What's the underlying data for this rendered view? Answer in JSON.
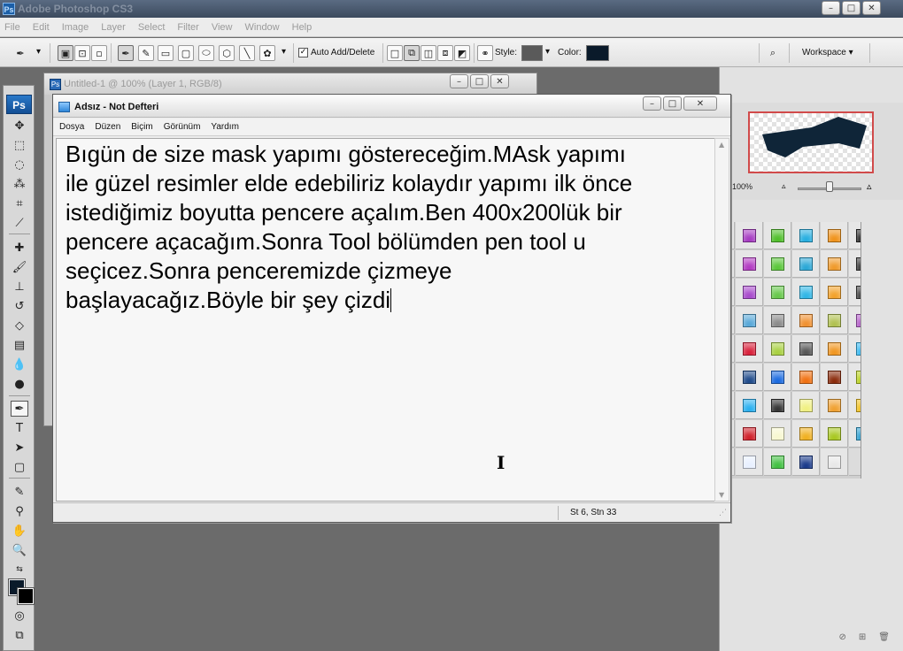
{
  "photoshop": {
    "title": "Adobe Photoshop CS3",
    "app_icon": "Ps",
    "menu": [
      "File",
      "Edit",
      "Image",
      "Layer",
      "Select",
      "Filter",
      "View",
      "Window",
      "Help"
    ],
    "options_bar": {
      "auto_add_delete_label": "Auto Add/Delete",
      "auto_add_delete_checked": "✓",
      "style_label": "Style:",
      "color_label": "Color:",
      "color_value": "#0a1a2a",
      "workspace_label": "Workspace"
    },
    "toolbox_badge": "Ps",
    "document": {
      "title": "Untitled-1 @ 100% (Layer 1, RGB/8)",
      "icon": "Ps"
    },
    "navigator": {
      "zoom_text": "100%"
    },
    "styles_colors": [
      [
        "#cf1a3a",
        "#a63bc2",
        "#4fbf2a",
        "#26aee0",
        "#f0921a",
        "#2b2b2b"
      ],
      [
        "#c9203a",
        "#b23ac2",
        "#5ac73a",
        "#2aa7d6",
        "#f09a2a",
        "#3a3a3a"
      ],
      [
        "#c0203a",
        "#a84acc",
        "#66c84a",
        "#2fb6e6",
        "#f3a22a",
        "#424242"
      ],
      [
        "#b8b8b8",
        "#58a8d8",
        "#8a8a8a",
        "#f09030",
        "#b0c050",
        "#b35ec8"
      ],
      [
        "#28a7c0",
        "#d8203a",
        "#a8d040",
        "#555555",
        "#f09620",
        "#38b8f0"
      ],
      [
        "#e82a5a",
        "#1e4a8a",
        "#1a6ae0",
        "#f07010",
        "#8a2a0a",
        "#b8d020"
      ],
      [
        "#111111",
        "#2ab0f0",
        "#333333",
        "#f0f080",
        "#f0a030",
        "#f0c020"
      ],
      [
        "#e0e0e0",
        "#d0202a",
        "#f8f8d0",
        "#f0b020",
        "#a8c820",
        "#30a0d0"
      ],
      [
        "#f0e8c8",
        "#e8f0ff",
        "#40c040",
        "#1a3a8a",
        "#e8e8e8",
        ""
      ]
    ]
  },
  "notepad": {
    "title": "Adsız - Not Defteri",
    "menu": [
      "Dosya",
      "Düzen",
      "Biçim",
      "Görünüm",
      "Yardım"
    ],
    "text": "Bıgün de size mask yapımı göstereceğim.MAsk yapımı\nile güzel resimler elde edebiliriz kolaydır yapımı ilk önce\nistediğimiz boyutta pencere açalım.Ben 400x200lük bir\npencere açacağım.Sonra Tool bölümden pen tool u\nseçicez.Sonra penceremizde çizmeye\nbaşlayacağız.Böyle bir şey çizdi",
    "status_position": "St 6, Stn 33"
  },
  "colors": {
    "foreground": "#0a1a2a",
    "background": "#000000",
    "shape_fill": "#0f2538"
  }
}
